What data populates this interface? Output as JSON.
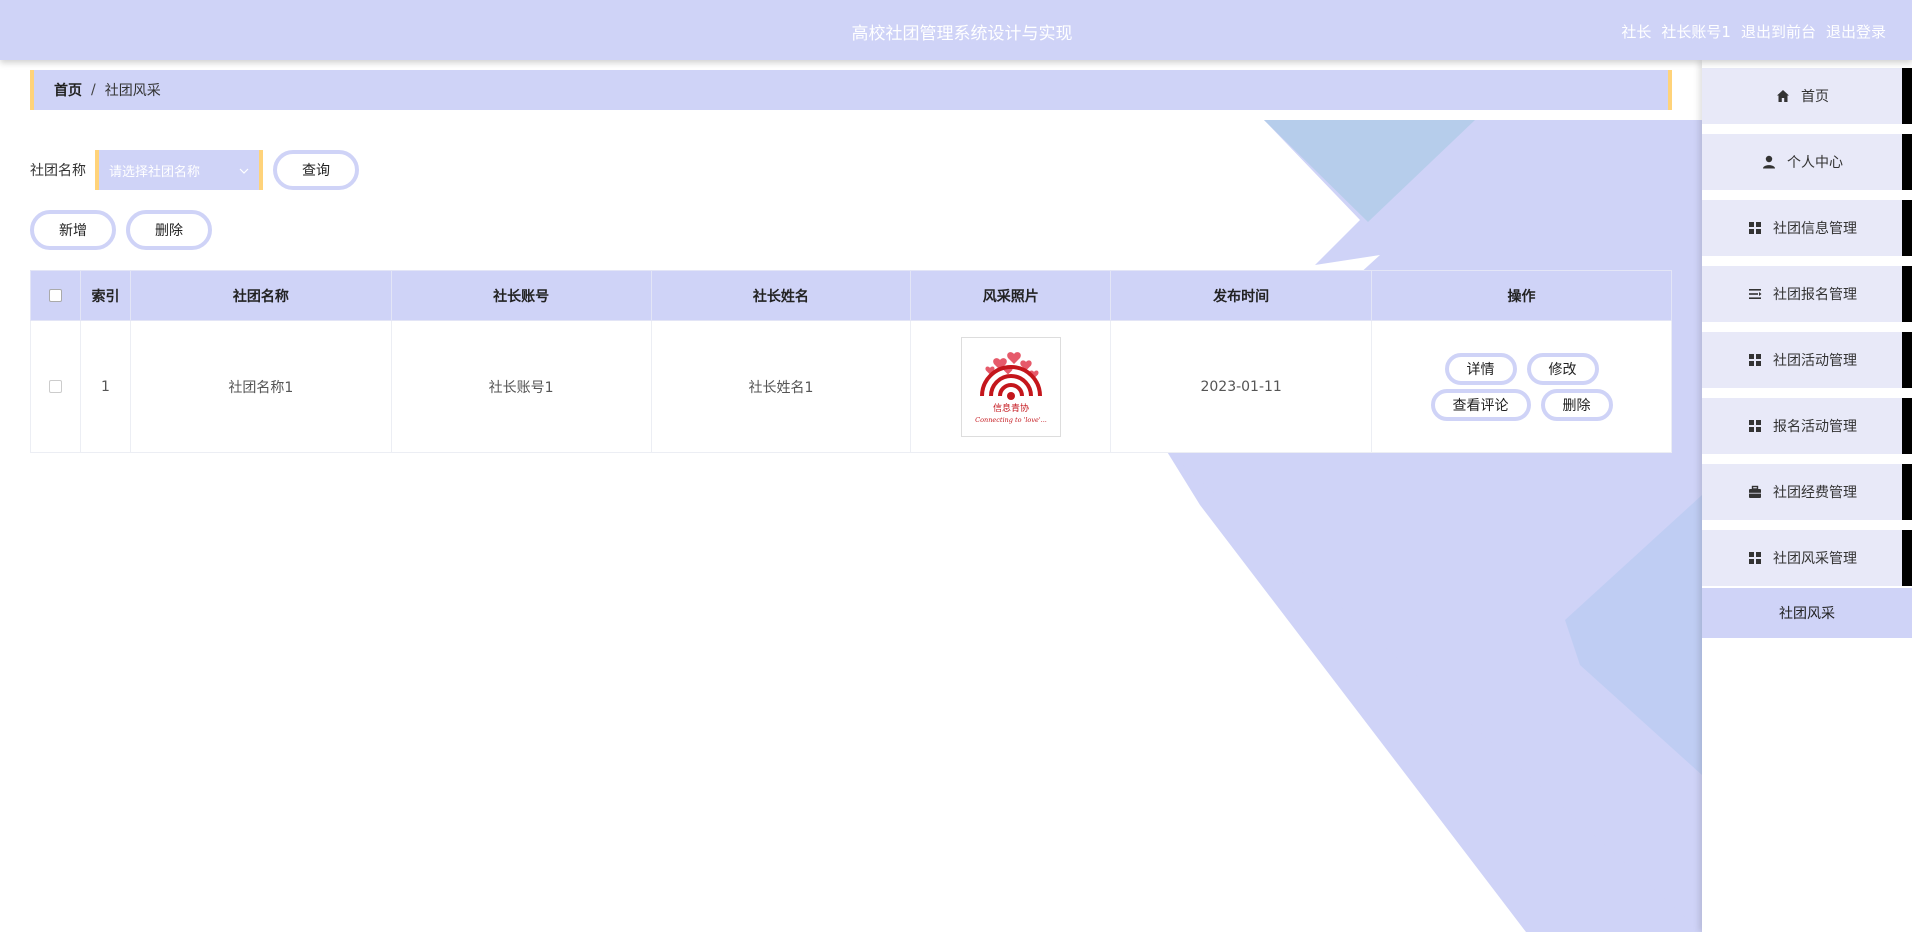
{
  "header": {
    "title": "高校社团管理系统设计与实现",
    "role": "社长",
    "username": "社长账号1",
    "front_link": "退出到前台",
    "logout_link": "退出登录"
  },
  "breadcrumb": {
    "home": "首页",
    "separator": "/",
    "current": "社团风采"
  },
  "search": {
    "label": "社团名称",
    "placeholder": "请选择社团名称",
    "query_button": "查询"
  },
  "actions": {
    "add_button": "新增",
    "delete_button": "删除"
  },
  "table": {
    "columns": [
      "索引",
      "社团名称",
      "社长账号",
      "社长姓名",
      "风采照片",
      "发布时间",
      "操作"
    ],
    "rows": [
      {
        "index": "1",
        "club_name": "社团名称1",
        "leader_account": "社长账号1",
        "leader_name": "社长姓名1",
        "photo_caption_cn": "信息青协",
        "photo_caption_en": "Connecting to 'love'...",
        "publish_time": "2023-01-11",
        "ops": {
          "detail": "详情",
          "edit": "修改",
          "comments": "查看评论",
          "delete": "删除"
        }
      }
    ]
  },
  "sidebar": {
    "items": [
      {
        "label": "首页",
        "icon": "home-icon"
      },
      {
        "label": "个人中心",
        "icon": "user-icon"
      },
      {
        "label": "社团信息管理",
        "icon": "grid-icon"
      },
      {
        "label": "社团报名管理",
        "icon": "list-icon"
      },
      {
        "label": "社团活动管理",
        "icon": "grid-icon"
      },
      {
        "label": "报名活动管理",
        "icon": "grid-icon"
      },
      {
        "label": "社团经费管理",
        "icon": "briefcase-icon"
      },
      {
        "label": "社团风采管理",
        "icon": "grid-icon"
      }
    ],
    "sub_item": "社团风采"
  },
  "colors": {
    "accent": "#cfd3f7",
    "border_accent": "#ffd37a",
    "side_item_bg": "#e8e9f8"
  }
}
